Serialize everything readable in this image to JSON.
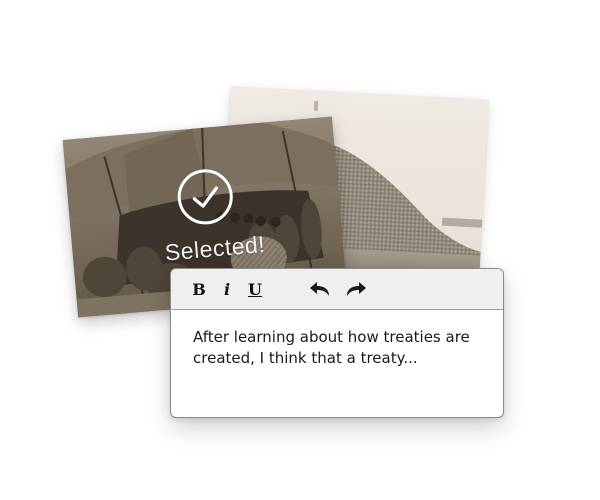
{
  "cards": {
    "front": {
      "photo_name": "tent-council-photo",
      "selected": true,
      "selected_label": "Selected!",
      "check_icon": "check-circle-icon"
    },
    "back": {
      "photo_name": "pile-photo"
    }
  },
  "editor": {
    "toolbar": {
      "bold_label": "B",
      "italic_label": "i",
      "underline_label": "U",
      "undo_icon": "undo-arrow-icon",
      "redo_icon": "redo-arrow-icon"
    },
    "text": "After learning about how treaties are created, I think that a treaty..."
  },
  "colors": {
    "toolbar_bg": "#efefef",
    "border": "#8a8a8a",
    "photo_sepia": "#7a6e5f",
    "overlay_text": "#ffffff"
  }
}
